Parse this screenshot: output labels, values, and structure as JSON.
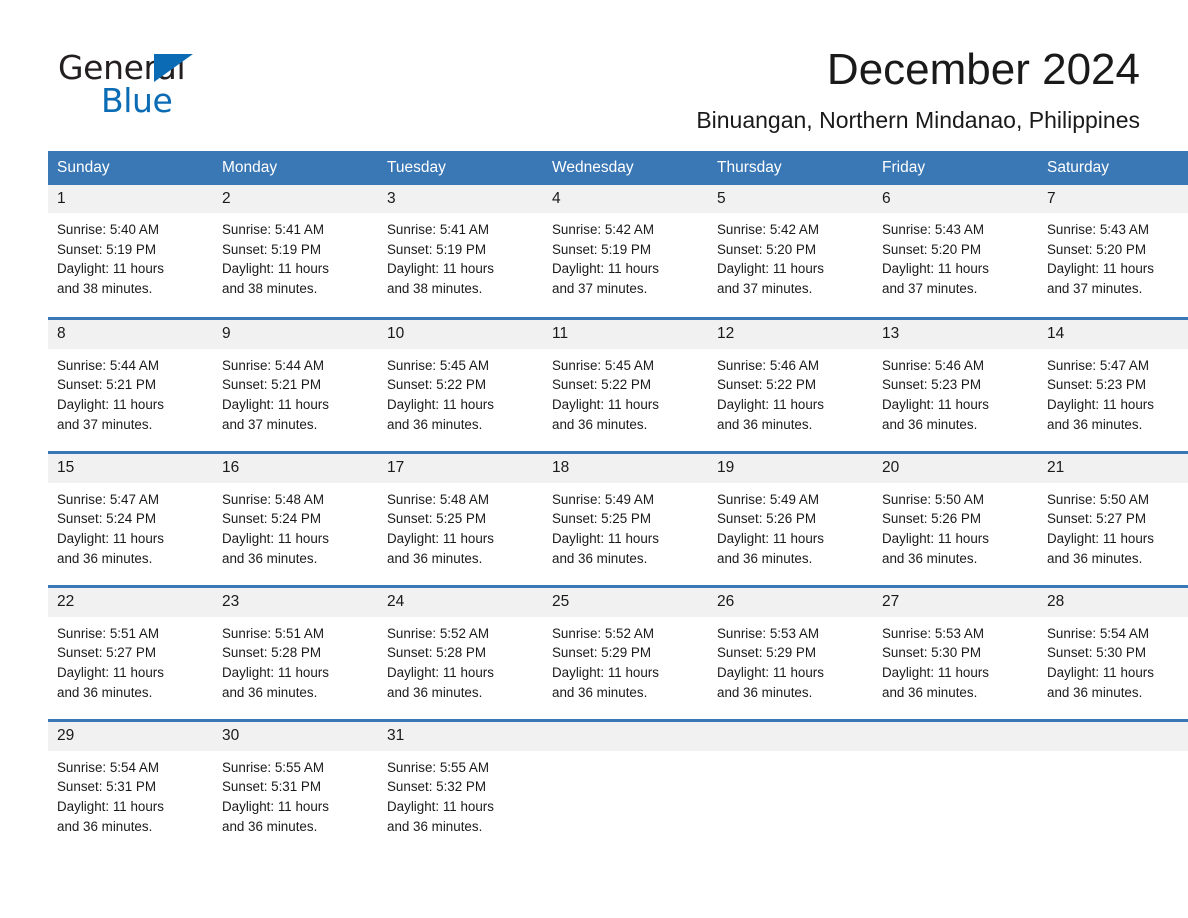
{
  "brand": {
    "name_part1": "General",
    "name_part2": "Blue",
    "accent_color": "#0b6cb5"
  },
  "header": {
    "month_title": "December 2024",
    "location": "Binuangan, Northern Mindanao, Philippines"
  },
  "theme": {
    "header_blue": "#3a77b5",
    "daynum_bg": "#f1f1f1",
    "text": "#1a1a1a"
  },
  "calendar": {
    "weekday_headers": [
      "Sunday",
      "Monday",
      "Tuesday",
      "Wednesday",
      "Thursday",
      "Friday",
      "Saturday"
    ],
    "weeks": [
      [
        {
          "day": "1",
          "sunrise": "Sunrise: 5:40 AM",
          "sunset": "Sunset: 5:19 PM",
          "daylight_line1": "Daylight: 11 hours",
          "daylight_line2": "and 38 minutes."
        },
        {
          "day": "2",
          "sunrise": "Sunrise: 5:41 AM",
          "sunset": "Sunset: 5:19 PM",
          "daylight_line1": "Daylight: 11 hours",
          "daylight_line2": "and 38 minutes."
        },
        {
          "day": "3",
          "sunrise": "Sunrise: 5:41 AM",
          "sunset": "Sunset: 5:19 PM",
          "daylight_line1": "Daylight: 11 hours",
          "daylight_line2": "and 38 minutes."
        },
        {
          "day": "4",
          "sunrise": "Sunrise: 5:42 AM",
          "sunset": "Sunset: 5:19 PM",
          "daylight_line1": "Daylight: 11 hours",
          "daylight_line2": "and 37 minutes."
        },
        {
          "day": "5",
          "sunrise": "Sunrise: 5:42 AM",
          "sunset": "Sunset: 5:20 PM",
          "daylight_line1": "Daylight: 11 hours",
          "daylight_line2": "and 37 minutes."
        },
        {
          "day": "6",
          "sunrise": "Sunrise: 5:43 AM",
          "sunset": "Sunset: 5:20 PM",
          "daylight_line1": "Daylight: 11 hours",
          "daylight_line2": "and 37 minutes."
        },
        {
          "day": "7",
          "sunrise": "Sunrise: 5:43 AM",
          "sunset": "Sunset: 5:20 PM",
          "daylight_line1": "Daylight: 11 hours",
          "daylight_line2": "and 37 minutes."
        }
      ],
      [
        {
          "day": "8",
          "sunrise": "Sunrise: 5:44 AM",
          "sunset": "Sunset: 5:21 PM",
          "daylight_line1": "Daylight: 11 hours",
          "daylight_line2": "and 37 minutes."
        },
        {
          "day": "9",
          "sunrise": "Sunrise: 5:44 AM",
          "sunset": "Sunset: 5:21 PM",
          "daylight_line1": "Daylight: 11 hours",
          "daylight_line2": "and 37 minutes."
        },
        {
          "day": "10",
          "sunrise": "Sunrise: 5:45 AM",
          "sunset": "Sunset: 5:22 PM",
          "daylight_line1": "Daylight: 11 hours",
          "daylight_line2": "and 36 minutes."
        },
        {
          "day": "11",
          "sunrise": "Sunrise: 5:45 AM",
          "sunset": "Sunset: 5:22 PM",
          "daylight_line1": "Daylight: 11 hours",
          "daylight_line2": "and 36 minutes."
        },
        {
          "day": "12",
          "sunrise": "Sunrise: 5:46 AM",
          "sunset": "Sunset: 5:22 PM",
          "daylight_line1": "Daylight: 11 hours",
          "daylight_line2": "and 36 minutes."
        },
        {
          "day": "13",
          "sunrise": "Sunrise: 5:46 AM",
          "sunset": "Sunset: 5:23 PM",
          "daylight_line1": "Daylight: 11 hours",
          "daylight_line2": "and 36 minutes."
        },
        {
          "day": "14",
          "sunrise": "Sunrise: 5:47 AM",
          "sunset": "Sunset: 5:23 PM",
          "daylight_line1": "Daylight: 11 hours",
          "daylight_line2": "and 36 minutes."
        }
      ],
      [
        {
          "day": "15",
          "sunrise": "Sunrise: 5:47 AM",
          "sunset": "Sunset: 5:24 PM",
          "daylight_line1": "Daylight: 11 hours",
          "daylight_line2": "and 36 minutes."
        },
        {
          "day": "16",
          "sunrise": "Sunrise: 5:48 AM",
          "sunset": "Sunset: 5:24 PM",
          "daylight_line1": "Daylight: 11 hours",
          "daylight_line2": "and 36 minutes."
        },
        {
          "day": "17",
          "sunrise": "Sunrise: 5:48 AM",
          "sunset": "Sunset: 5:25 PM",
          "daylight_line1": "Daylight: 11 hours",
          "daylight_line2": "and 36 minutes."
        },
        {
          "day": "18",
          "sunrise": "Sunrise: 5:49 AM",
          "sunset": "Sunset: 5:25 PM",
          "daylight_line1": "Daylight: 11 hours",
          "daylight_line2": "and 36 minutes."
        },
        {
          "day": "19",
          "sunrise": "Sunrise: 5:49 AM",
          "sunset": "Sunset: 5:26 PM",
          "daylight_line1": "Daylight: 11 hours",
          "daylight_line2": "and 36 minutes."
        },
        {
          "day": "20",
          "sunrise": "Sunrise: 5:50 AM",
          "sunset": "Sunset: 5:26 PM",
          "daylight_line1": "Daylight: 11 hours",
          "daylight_line2": "and 36 minutes."
        },
        {
          "day": "21",
          "sunrise": "Sunrise: 5:50 AM",
          "sunset": "Sunset: 5:27 PM",
          "daylight_line1": "Daylight: 11 hours",
          "daylight_line2": "and 36 minutes."
        }
      ],
      [
        {
          "day": "22",
          "sunrise": "Sunrise: 5:51 AM",
          "sunset": "Sunset: 5:27 PM",
          "daylight_line1": "Daylight: 11 hours",
          "daylight_line2": "and 36 minutes."
        },
        {
          "day": "23",
          "sunrise": "Sunrise: 5:51 AM",
          "sunset": "Sunset: 5:28 PM",
          "daylight_line1": "Daylight: 11 hours",
          "daylight_line2": "and 36 minutes."
        },
        {
          "day": "24",
          "sunrise": "Sunrise: 5:52 AM",
          "sunset": "Sunset: 5:28 PM",
          "daylight_line1": "Daylight: 11 hours",
          "daylight_line2": "and 36 minutes."
        },
        {
          "day": "25",
          "sunrise": "Sunrise: 5:52 AM",
          "sunset": "Sunset: 5:29 PM",
          "daylight_line1": "Daylight: 11 hours",
          "daylight_line2": "and 36 minutes."
        },
        {
          "day": "26",
          "sunrise": "Sunrise: 5:53 AM",
          "sunset": "Sunset: 5:29 PM",
          "daylight_line1": "Daylight: 11 hours",
          "daylight_line2": "and 36 minutes."
        },
        {
          "day": "27",
          "sunrise": "Sunrise: 5:53 AM",
          "sunset": "Sunset: 5:30 PM",
          "daylight_line1": "Daylight: 11 hours",
          "daylight_line2": "and 36 minutes."
        },
        {
          "day": "28",
          "sunrise": "Sunrise: 5:54 AM",
          "sunset": "Sunset: 5:30 PM",
          "daylight_line1": "Daylight: 11 hours",
          "daylight_line2": "and 36 minutes."
        }
      ],
      [
        {
          "day": "29",
          "sunrise": "Sunrise: 5:54 AM",
          "sunset": "Sunset: 5:31 PM",
          "daylight_line1": "Daylight: 11 hours",
          "daylight_line2": "and 36 minutes."
        },
        {
          "day": "30",
          "sunrise": "Sunrise: 5:55 AM",
          "sunset": "Sunset: 5:31 PM",
          "daylight_line1": "Daylight: 11 hours",
          "daylight_line2": "and 36 minutes."
        },
        {
          "day": "31",
          "sunrise": "Sunrise: 5:55 AM",
          "sunset": "Sunset: 5:32 PM",
          "daylight_line1": "Daylight: 11 hours",
          "daylight_line2": "and 36 minutes."
        },
        {
          "day": "",
          "sunrise": "",
          "sunset": "",
          "daylight_line1": "",
          "daylight_line2": ""
        },
        {
          "day": "",
          "sunrise": "",
          "sunset": "",
          "daylight_line1": "",
          "daylight_line2": ""
        },
        {
          "day": "",
          "sunrise": "",
          "sunset": "",
          "daylight_line1": "",
          "daylight_line2": ""
        },
        {
          "day": "",
          "sunrise": "",
          "sunset": "",
          "daylight_line1": "",
          "daylight_line2": ""
        }
      ]
    ]
  }
}
